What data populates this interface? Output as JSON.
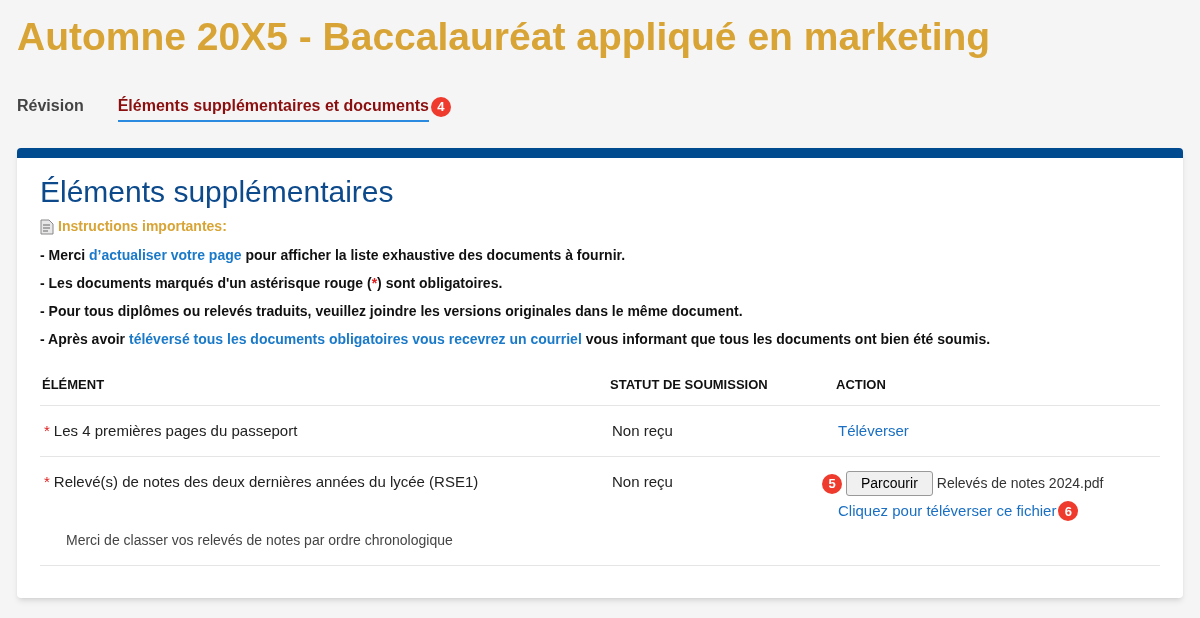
{
  "title": "Automne 20X5 - Baccalauréat appliqué en marketing",
  "tabs": [
    {
      "label": "Révision",
      "selected": false
    },
    {
      "label": "Éléments supplémentaires et documents",
      "selected": true,
      "marker": "4"
    }
  ],
  "section": {
    "heading": "Éléments supplémentaires",
    "instructions_title": "Instructions importantes:",
    "instructions": [
      [
        {
          "kind": "text",
          "text": "- Merci "
        },
        {
          "kind": "link",
          "text": "d’actualiser votre page"
        },
        {
          "kind": "text",
          "text": " pour afficher la liste exhaustive des documents à fournir."
        }
      ],
      [
        {
          "kind": "text",
          "text": "- Les documents marqués d'un astérisque rouge ("
        },
        {
          "kind": "asterisk",
          "text": "*"
        },
        {
          "kind": "text",
          "text": ") sont obligatoires."
        }
      ],
      [
        {
          "kind": "text",
          "text": "- Pour tous diplômes ou relevés traduits, veuillez joindre les versions originales dans le même document."
        }
      ],
      [
        {
          "kind": "text",
          "text": "- Après avoir "
        },
        {
          "kind": "link",
          "text": "téléversé tous les documents obligatoires vous recevrez un courriel"
        },
        {
          "kind": "text",
          "text": " vous informant que tous les documents ont bien été soumis."
        }
      ]
    ]
  },
  "table": {
    "columns": [
      "ÉLÉMENT",
      "STATUT DE SOUMISSION",
      "ACTION"
    ],
    "rows": [
      {
        "required_mark": "*",
        "element": "Les 4 premières pages du passeport",
        "status": "Non reçu",
        "action": {
          "kind": "link",
          "label": "Téléverser"
        }
      },
      {
        "required_mark": "*",
        "element": "Relevé(s) de notes des deux dernières années du lycée (RSE1)",
        "note": "Merci de classer vos relevés de notes par ordre chronologique",
        "status": "Non reçu",
        "action": {
          "kind": "file",
          "button": "Parcourir",
          "button_marker": "5",
          "file_name": "Relevés de notes 2024.pdf",
          "link": "Cliquez pour téléverser ce fichier",
          "link_marker": "6"
        }
      }
    ]
  }
}
